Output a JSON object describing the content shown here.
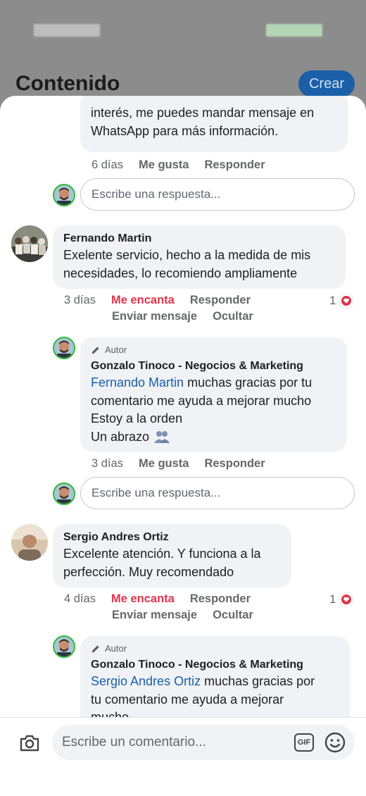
{
  "background": {
    "title": "Contenido",
    "create_button": "Crear"
  },
  "comments": [
    {
      "reply_fragment": {
        "line1": "interés, me puedes mandar mensaje en",
        "line2": "WhatsApp para más información.",
        "time": "6 días",
        "like": "Me gusta",
        "reply": "Responder"
      },
      "reply_input_placeholder": "Escribe una respuesta..."
    },
    {
      "author": "Fernando Martin",
      "text_line1": "Exelente servicio, hecho a la medida de mis",
      "text_line2": "necesidades, lo recomiendo ampliamente",
      "time": "3 días",
      "reaction": "Me encanta",
      "reply": "Responder",
      "send_message": "Enviar mensaje",
      "hide": "Ocultar",
      "like_count": "1",
      "owner_reply": {
        "tag": "Autor",
        "author": "Gonzalo Tinoco - Negocios & Marketing",
        "mention": "Fernando Martin",
        "text_after_mention": " muchas gracias por tu",
        "line2": "comentario me ayuda a mejorar mucho",
        "line3": "Estoy a la orden",
        "line4": "Un abrazo",
        "time": "3 días",
        "like": "Me gusta",
        "reply": "Responder"
      },
      "reply_input_placeholder": "Escribe una respuesta..."
    },
    {
      "author": "Sergio Andres Ortiz",
      "text_line1": "Excelente atención. Y funciona a la",
      "text_line2": "perfección. Muy recomendado",
      "time": "4 días",
      "reaction": "Me encanta",
      "reply": "Responder",
      "send_message": "Enviar mensaje",
      "hide": "Ocultar",
      "like_count": "1",
      "owner_reply": {
        "tag": "Autor",
        "author": "Gonzalo Tinoco - Negocios & Marketing",
        "mention": "Sergio Andres Ortiz",
        "text_after_mention": " muchas gracias por",
        "line2": "tu comentario me ayuda a mejorar",
        "line3": "mucho"
      }
    }
  ],
  "composer": {
    "placeholder": "Escribe un comentario...",
    "gif_label": "GIF"
  },
  "colors": {
    "accent": "#1a5fa8",
    "love": "#e0344d",
    "bubble": "#f0f2f5"
  }
}
